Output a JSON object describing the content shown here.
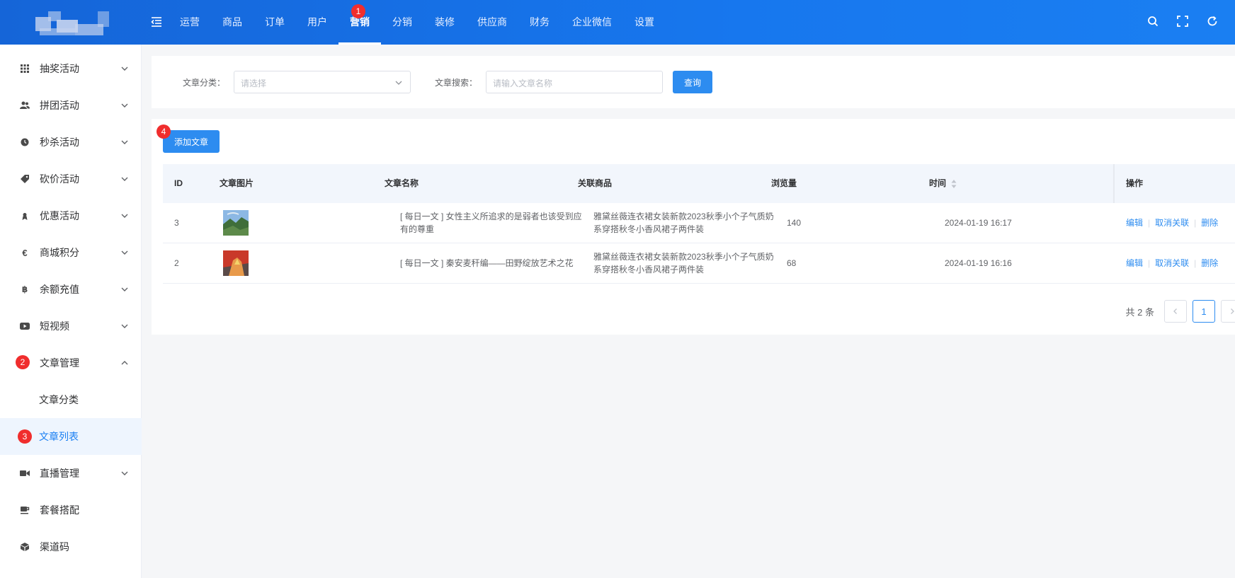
{
  "nav": {
    "items": [
      "运营",
      "商品",
      "订单",
      "用户",
      "营销",
      "分销",
      "装修",
      "供应商",
      "财务",
      "企业微信",
      "设置"
    ],
    "active_index": 4
  },
  "markers": [
    "1",
    "2",
    "3",
    "4"
  ],
  "sidebar": {
    "items": [
      {
        "label": "抽奖活动",
        "icon": "grid-icon"
      },
      {
        "label": "拼团活动",
        "icon": "users-icon"
      },
      {
        "label": "秒杀活动",
        "icon": "clock-icon"
      },
      {
        "label": "砍价活动",
        "icon": "tag-icon"
      },
      {
        "label": "优惠活动",
        "icon": "gift-icon"
      },
      {
        "label": "商城积分",
        "icon": "euro-icon"
      },
      {
        "label": "余额充值",
        "icon": "bitcoin-icon"
      },
      {
        "label": "短视频",
        "icon": "youtube-icon"
      },
      {
        "label": "文章管理",
        "icon": "",
        "expanded": true
      },
      {
        "label": "文章分类",
        "sub": true
      },
      {
        "label": "文章列表",
        "sub": true,
        "active": true
      },
      {
        "label": "直播管理",
        "icon": "video-camera-icon"
      },
      {
        "label": "套餐搭配",
        "icon": "coffee-icon"
      },
      {
        "label": "渠道码",
        "icon": "cube-icon"
      }
    ]
  },
  "search": {
    "category_label": "文章分类：",
    "category_placeholder": "请选择",
    "keyword_label": "文章搜索：",
    "keyword_placeholder": "请输入文章名称",
    "query_button": "查询"
  },
  "toolbar": {
    "add_button": "添加文章"
  },
  "table": {
    "columns": [
      "ID",
      "文章图片",
      "文章名称",
      "关联商品",
      "浏览量",
      "时间",
      "操作"
    ],
    "rows": [
      {
        "id": "3",
        "title_line1": "[ 每日一文 ] 女性主义所追求的是弱者也该受到应",
        "title_line2": "有的尊重",
        "product_line1": "雅黛丝薇连衣裙女装新款2023秋季小个子气质奶",
        "product_line2": "系穿搭秋冬小香风裙子两件装",
        "views": "140",
        "time": "2024-01-19 16:17",
        "thumb_colors": [
          "#7fb0e0",
          "#3f6e3a",
          "#c9d8e6"
        ]
      },
      {
        "id": "2",
        "title_line1": "[ 每日一文 ] 秦安麦秆编——田野绽放艺术之花",
        "title_line2": "",
        "product_line1": "雅黛丝薇连衣裙女装新款2023秋季小个子气质奶",
        "product_line2": "系穿搭秋冬小香风裙子两件装",
        "views": "68",
        "time": "2024-01-19 16:16",
        "thumb_colors": [
          "#c9392a",
          "#e89a4a",
          "#5a4a48"
        ]
      }
    ],
    "actions": {
      "edit": "编辑",
      "unlink": "取消关联",
      "delete": "删除"
    }
  },
  "pagination": {
    "total_text": "共 2 条",
    "current_page": "1"
  },
  "colors": {
    "primary": "#2d8cf0",
    "header": "#1777ee",
    "badge": "#f02d2d"
  }
}
